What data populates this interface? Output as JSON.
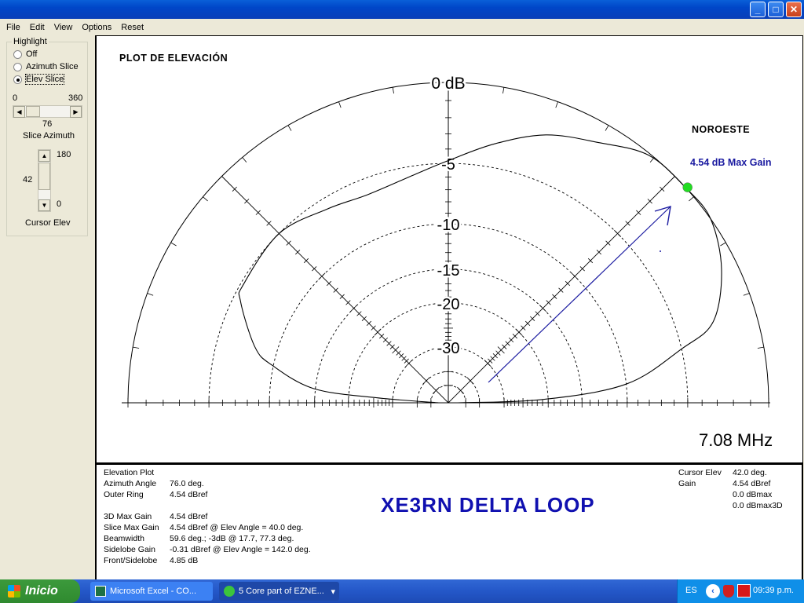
{
  "window": {
    "minimize": "_",
    "maximize": "□",
    "close": "✕"
  },
  "menu": [
    "File",
    "Edit",
    "View",
    "Options",
    "Reset"
  ],
  "highlight": {
    "legend": "Highlight",
    "options": [
      {
        "label": "Off",
        "selected": false
      },
      {
        "label": "Azimuth Slice",
        "selected": false
      },
      {
        "label": "Elev Slice",
        "selected": true
      }
    ]
  },
  "slice_azimuth": {
    "min": "0",
    "max": "360",
    "value": "76",
    "label": "Slice Azimuth",
    "fraction": 0.211
  },
  "cursor_elev": {
    "max": "180",
    "min": "0",
    "value": "42",
    "label": "Cursor Elev",
    "fraction": 0.233
  },
  "plot": {
    "title": "PLOT DE ELEVACIÓN",
    "direction": "NOROESTE",
    "max_gain_label": "4.54 dB Max Gain",
    "frequency": "7.08 MHz",
    "cursor_color": "#22dd22",
    "annotation_color": "#1a1aa0"
  },
  "chart_data": {
    "type": "polar-elevation",
    "title": "PLOT DE ELEVACIÓN",
    "scale": "ARRL log",
    "ring_labels": [
      {
        "db": 0,
        "label": "0 dB"
      },
      {
        "db": -5,
        "label": "-5"
      },
      {
        "db": -10,
        "label": "-10"
      },
      {
        "db": -15,
        "label": "-15"
      },
      {
        "db": -20,
        "label": "-20"
      },
      {
        "db": -30,
        "label": "-30"
      }
    ],
    "extra_rings_db": [
      -40,
      -50
    ],
    "angle_range": [
      0,
      180
    ],
    "cursor_angle": 42,
    "series": [
      {
        "name": "elevation pattern (dB rel. outer ring)",
        "points": [
          [
            0,
            -60
          ],
          [
            2,
            -21
          ],
          [
            6,
            -10
          ],
          [
            13,
            -5
          ],
          [
            17,
            -2.5
          ],
          [
            26,
            -0.9
          ],
          [
            35,
            0
          ],
          [
            42,
            0
          ],
          [
            51,
            -0.1
          ],
          [
            60,
            -1.1
          ],
          [
            70,
            -2.0
          ],
          [
            80,
            -3.4
          ],
          [
            90,
            -4.8
          ],
          [
            98,
            -5.6
          ],
          [
            111,
            -6.2
          ],
          [
            122,
            -5.8
          ],
          [
            135,
            -5.0
          ],
          [
            150,
            -5.2
          ],
          [
            154,
            -5.6
          ],
          [
            164,
            -8.0
          ],
          [
            168,
            -9.9
          ],
          [
            174,
            -14.8
          ],
          [
            176,
            -25.6
          ],
          [
            180,
            -60
          ]
        ]
      }
    ]
  },
  "info_left": [
    {
      "k": "Elevation Plot",
      "v": ""
    },
    {
      "k": "Azimuth Angle",
      "v": "76.0 deg."
    },
    {
      "k": "Outer Ring",
      "v": "4.54 dBref"
    },
    {
      "k": "3D Max Gain",
      "v": "4.54 dBref"
    },
    {
      "k": "Slice Max Gain",
      "v": "4.54 dBref @ Elev Angle = 40.0 deg."
    },
    {
      "k": "Beamwidth",
      "v": "59.6 deg.; -3dB @ 17.7, 77.3 deg."
    },
    {
      "k": "Sidelobe Gain",
      "v": "-0.31 dBref @ Elev Angle = 142.0 deg."
    },
    {
      "k": "Front/Sidelobe",
      "v": "4.85 dB"
    }
  ],
  "info_right": [
    {
      "k": "Cursor Elev",
      "v": "42.0 deg."
    },
    {
      "k": "Gain",
      "v": "4.54 dBref"
    },
    {
      "k": "",
      "v": "0.0 dBmax"
    },
    {
      "k": "",
      "v": "0.0 dBmax3D"
    }
  ],
  "banner": "XE3RN DELTA LOOP",
  "taskbar": {
    "start": "Inicio",
    "tasks": [
      "Microsoft Excel - CO...",
      "5 Core part of EZNE..."
    ],
    "lang": "ES",
    "clock": "09:39 p.m."
  }
}
